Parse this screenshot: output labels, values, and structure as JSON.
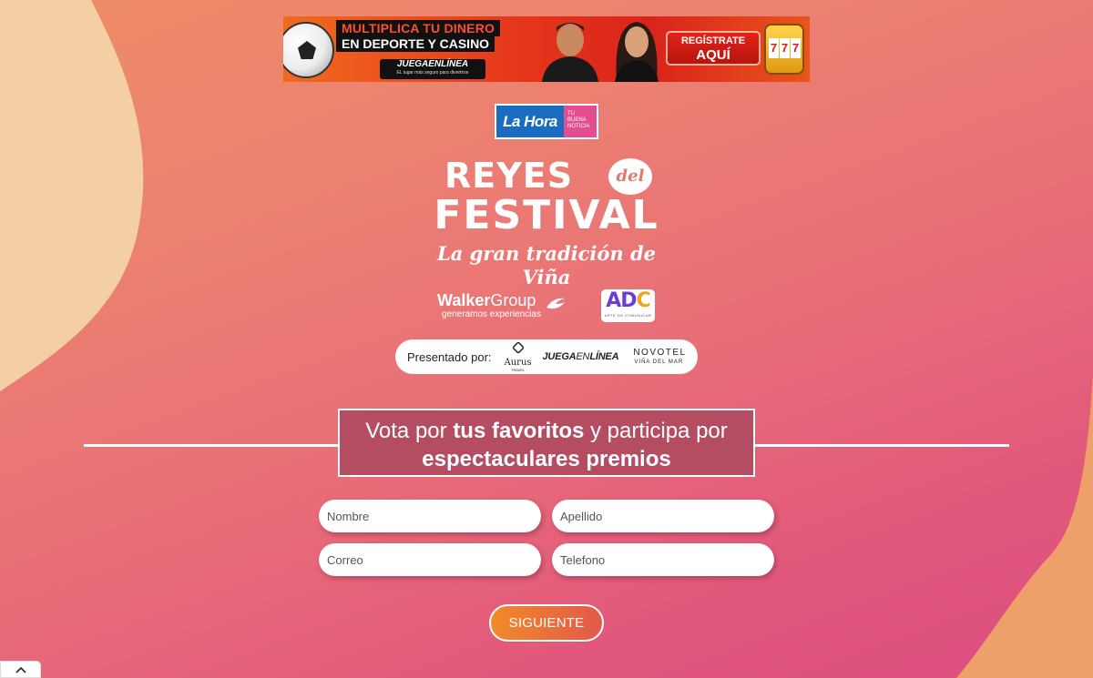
{
  "banner": {
    "line1": "MULTIPLICA TU DINERO",
    "line2": "EN DEPORTE Y CASINO",
    "brand": "JUEGAENLÍNEA",
    "brand_tagline": "EL lugar más seguro para divertirse",
    "cta_line1": "REGÍSTRATE",
    "cta_line2": "AQUÍ",
    "slot_symbols": [
      "7",
      "7",
      "7"
    ]
  },
  "lahora": {
    "name": "La Hora",
    "tagline1": "TU",
    "tagline2": "BUENA",
    "tagline3": "NOTICIA"
  },
  "event_logo": {
    "word1": "REYES",
    "word_del": "del",
    "word2": "FESTIVAL",
    "tagline": "La gran tradición de Viña"
  },
  "sponsors": {
    "walker_bold": "Walker",
    "walker_regular": "Group",
    "walker_tagline": "generamos experiencias",
    "adc_letters_a": "AD",
    "adc_letters_c": "C",
    "adc_sub": "ARTE DE COMUNICAR"
  },
  "presented": {
    "label": "Presentado por:",
    "aurus": "Aurus",
    "aurus_sub": "TRAVEL",
    "juega_bold": "JUEGA",
    "juega_regular": "EN",
    "juega_end": "LÍNEA",
    "novotel": "NOVOTEL",
    "novotel_sub": "VIÑA DEL MAR"
  },
  "headline": {
    "part1": "Vota por ",
    "part2": "tus favoritos",
    "part3": " y participa por",
    "part4": "espectaculares premios"
  },
  "form": {
    "nombre_placeholder": "Nombre",
    "apellido_placeholder": "Apellido",
    "correo_placeholder": "Correo",
    "telefono_placeholder": "Telefono",
    "submit_label": "SIGUIENTE"
  },
  "colors": {
    "bg_top": "#ee8d66",
    "bg_bottom": "#db4d80",
    "headline_box": "#b44d62",
    "button_start": "#f28a2a",
    "button_end": "#e2584a",
    "cream_blob": "#f5cfa4"
  },
  "icons": {
    "scroll_top": "chevron-up-icon"
  }
}
